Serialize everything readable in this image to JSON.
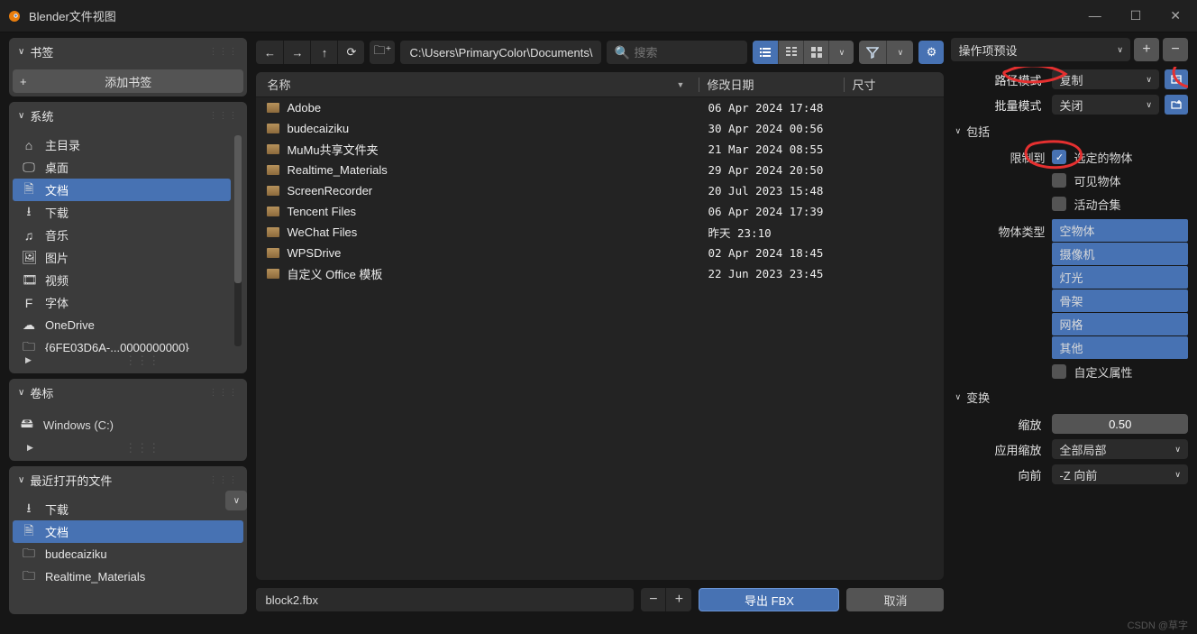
{
  "window": {
    "title": "Blender文件视图"
  },
  "bookmarks": {
    "title": "书签",
    "add": "添加书签"
  },
  "system": {
    "title": "系统",
    "items": [
      {
        "label": "主目录",
        "icon": "home",
        "sel": false
      },
      {
        "label": "桌面",
        "icon": "desktop",
        "sel": false
      },
      {
        "label": "文档",
        "icon": "doc",
        "sel": true
      },
      {
        "label": "下载",
        "icon": "download",
        "sel": false
      },
      {
        "label": "音乐",
        "icon": "music",
        "sel": false
      },
      {
        "label": "图片",
        "icon": "image",
        "sel": false
      },
      {
        "label": "视频",
        "icon": "video",
        "sel": false
      },
      {
        "label": "字体",
        "icon": "font",
        "sel": false
      },
      {
        "label": "OneDrive",
        "icon": "cloud",
        "sel": false
      },
      {
        "label": "{6FE03D6A-...0000000000}",
        "icon": "folder",
        "sel": false
      }
    ]
  },
  "volumes": {
    "title": "卷标",
    "items": [
      {
        "label": "Windows (C:)",
        "icon": "drive"
      }
    ]
  },
  "recent": {
    "title": "最近打开的文件",
    "items": [
      {
        "label": "下载",
        "icon": "download",
        "sel": false
      },
      {
        "label": "文档",
        "icon": "doc",
        "sel": true
      },
      {
        "label": "budecaiziku",
        "icon": "folder",
        "sel": false
      },
      {
        "label": "Realtime_Materials",
        "icon": "folder",
        "sel": false
      }
    ]
  },
  "path": "C:\\Users\\PrimaryColor\\Documents\\",
  "search": {
    "placeholder": "搜索"
  },
  "columns": {
    "name": "名称",
    "date": "修改日期",
    "size": "尺寸"
  },
  "files": [
    {
      "name": "Adobe",
      "date": "06 Apr 2024 17:48"
    },
    {
      "name": "budecaiziku",
      "date": "30 Apr 2024 00:56"
    },
    {
      "name": "MuMu共享文件夹",
      "date": "21 Mar 2024 08:55"
    },
    {
      "name": "Realtime_Materials",
      "date": "29 Apr 2024 20:50"
    },
    {
      "name": "ScreenRecorder",
      "date": "20 Jul 2023 15:48"
    },
    {
      "name": "Tencent Files",
      "date": "06 Apr 2024 17:39"
    },
    {
      "name": "WeChat Files",
      "date": "昨天 23:10"
    },
    {
      "name": "WPSDrive",
      "date": "02 Apr 2024 18:45"
    },
    {
      "name": "自定义 Office 模板",
      "date": "22 Jun 2023 23:45"
    }
  ],
  "filename": "block2.fbx",
  "buttons": {
    "export": "导出 FBX",
    "cancel": "取消"
  },
  "preset": {
    "label": "操作项预设"
  },
  "options": {
    "pathmode_label": "路径模式",
    "pathmode_value": "复制",
    "batchmode_label": "批量模式",
    "batchmode_value": "关闭",
    "include": "包括",
    "limit_label": "限制到",
    "limit_opts": [
      {
        "label": "选定的物体",
        "checked": true
      },
      {
        "label": "可见物体",
        "checked": false
      },
      {
        "label": "活动合集",
        "checked": false
      }
    ],
    "objtype_label": "物体类型",
    "objtypes": [
      "空物体",
      "摄像机",
      "灯光",
      "骨架",
      "网格",
      "其他"
    ],
    "custom_props": "自定义属性",
    "transform": "变换",
    "scale_label": "缩放",
    "scale_value": "0.50",
    "applyscale_label": "应用缩放",
    "applyscale_value": "全部局部",
    "forward_label": "向前",
    "forward_value": "-Z 向前"
  },
  "watermark": "CSDN @草字"
}
